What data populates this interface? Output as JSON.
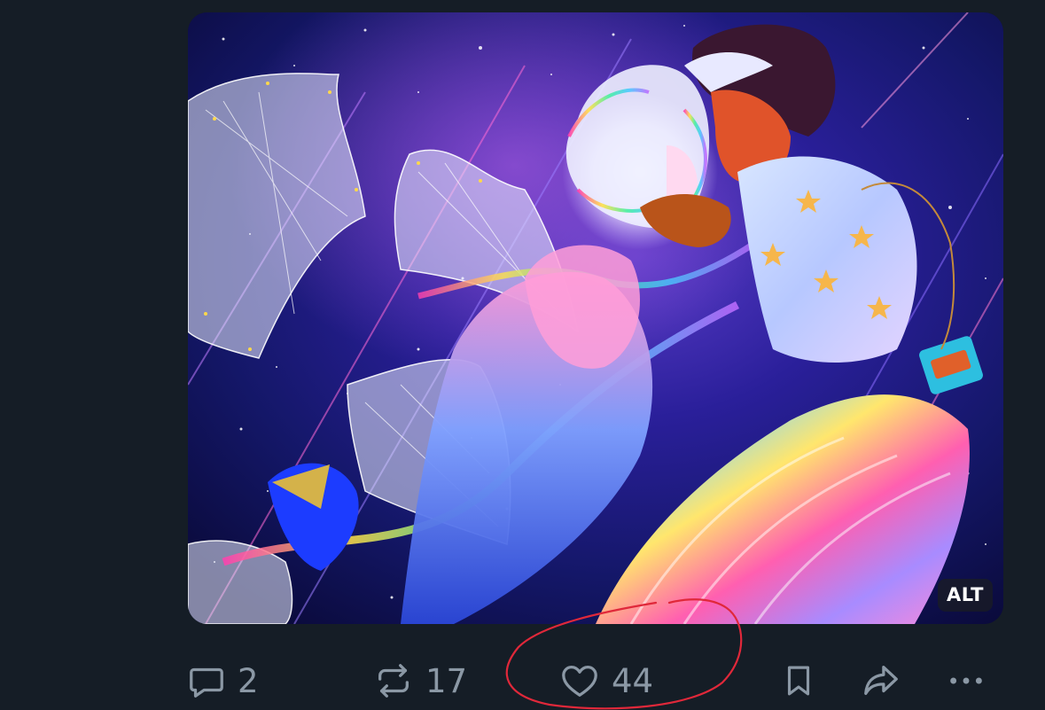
{
  "media": {
    "image_label": "space-dance-illustration",
    "alt_badge": "ALT"
  },
  "actions": {
    "reply_count": "2",
    "repost_count": "17",
    "like_count": "44"
  },
  "colors": {
    "background": "#151d26",
    "icon": "#8b98a5",
    "annotation": "#e0283a"
  },
  "icons": [
    "reply-icon",
    "repost-icon",
    "like-icon",
    "bookmark-icon",
    "share-icon",
    "more-icon"
  ]
}
